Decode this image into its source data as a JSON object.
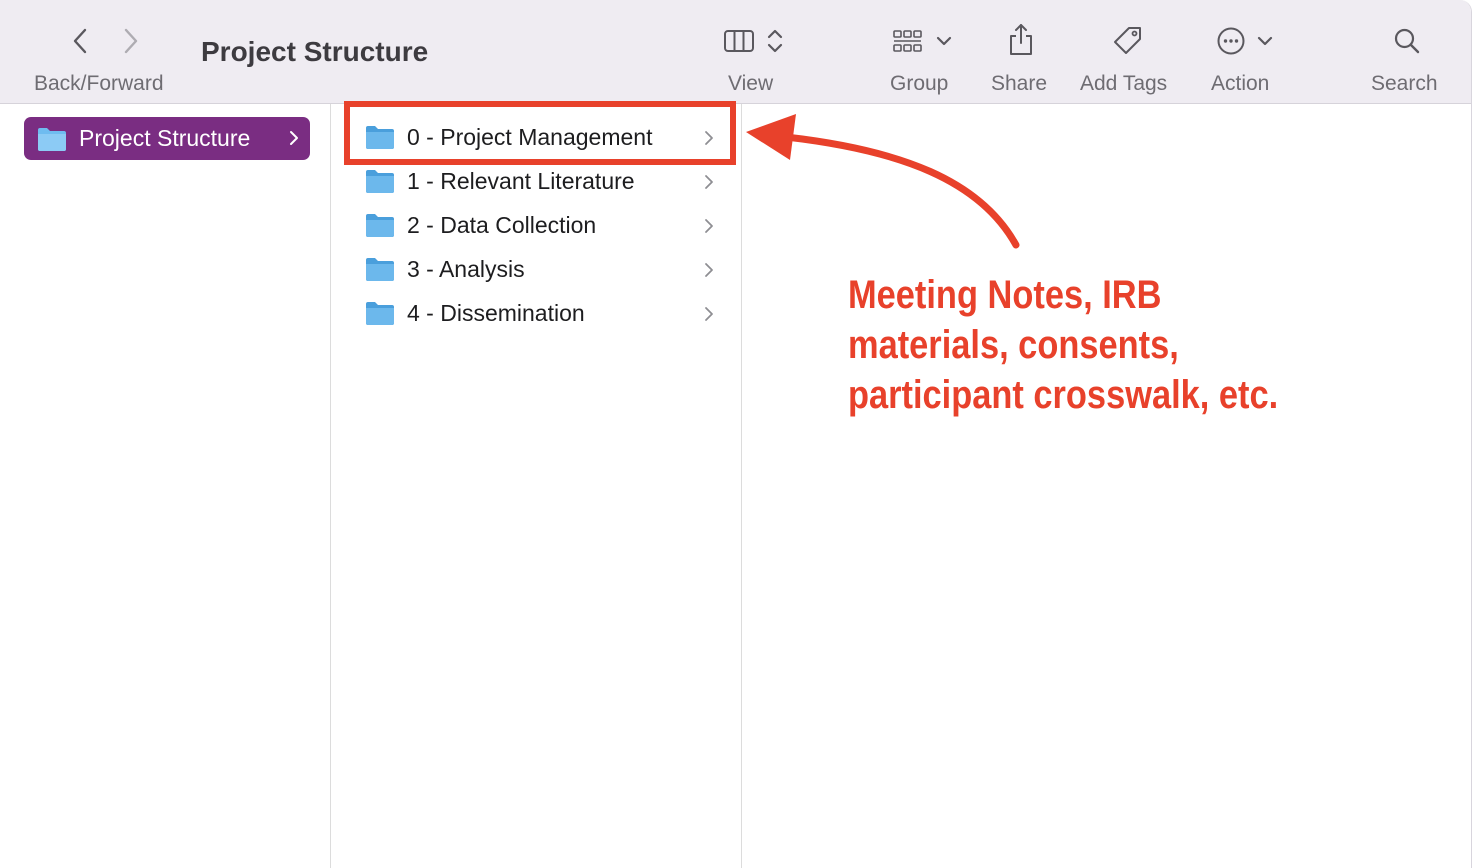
{
  "toolbar": {
    "back_forward_label": "Back/Forward",
    "title": "Project Structure",
    "view_label": "View",
    "group_label": "Group",
    "share_label": "Share",
    "add_tags_label": "Add Tags",
    "action_label": "Action",
    "search_label": "Search"
  },
  "sidebar": {
    "selected_folder": "Project Structure"
  },
  "folders": [
    {
      "label": "0 - Project Management"
    },
    {
      "label": "1 - Relevant Literature"
    },
    {
      "label": "2 - Data Collection"
    },
    {
      "label": "3 - Analysis"
    },
    {
      "label": "4 - Dissemination"
    }
  ],
  "annotation": {
    "lines": [
      "Meeting Notes, IRB",
      "materials, consents,",
      "participant crosswalk, etc."
    ],
    "color": "#e8412b"
  },
  "colors": {
    "selection": "#7a2d82",
    "folder_blue": "#5eb3e8",
    "toolbar_bg": "#efecf2"
  }
}
